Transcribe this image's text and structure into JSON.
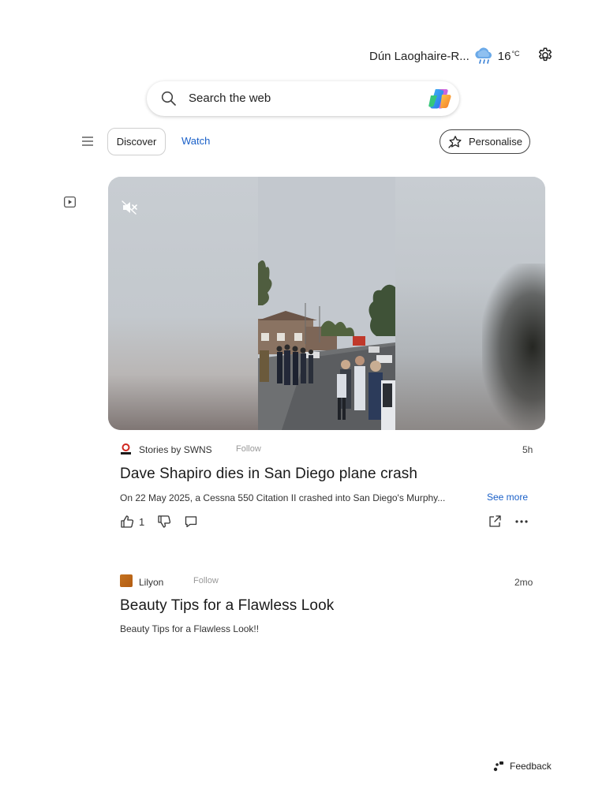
{
  "header": {
    "location": "Dún Laoghaire-R...",
    "temperature": "16",
    "unit": "°C",
    "weather_icon": "rain-cloud-icon",
    "settings_icon": "gear-icon"
  },
  "search": {
    "placeholder": "Search the web",
    "icon": "search-icon",
    "assistant_icon": "copilot-icon"
  },
  "nav": {
    "menu_icon": "hamburger-icon",
    "tabs": [
      {
        "label": "Discover",
        "active": false
      },
      {
        "label": "Watch",
        "active": true
      }
    ],
    "personalise_label": "Personalise"
  },
  "feed": {
    "items": [
      {
        "source": "Stories by SWNS",
        "follow_label": "Follow",
        "time": "5h",
        "title": "Dave Shapiro dies in San Diego plane crash",
        "description": "On 22 May 2025, a Cessna 550 Citation II crashed into San Diego's Murphy...",
        "see_more": "See more",
        "likes": "1",
        "has_video": true
      },
      {
        "source": "Lilyon",
        "follow_label": "Follow",
        "time": "2mo",
        "title": "Beauty Tips for a Flawless Look",
        "description": "Beauty Tips for a Flawless Look!!"
      }
    ]
  },
  "footer": {
    "feedback_label": "Feedback"
  },
  "colors": {
    "accent": "#1a60c8",
    "text": "#1a1a1a"
  }
}
